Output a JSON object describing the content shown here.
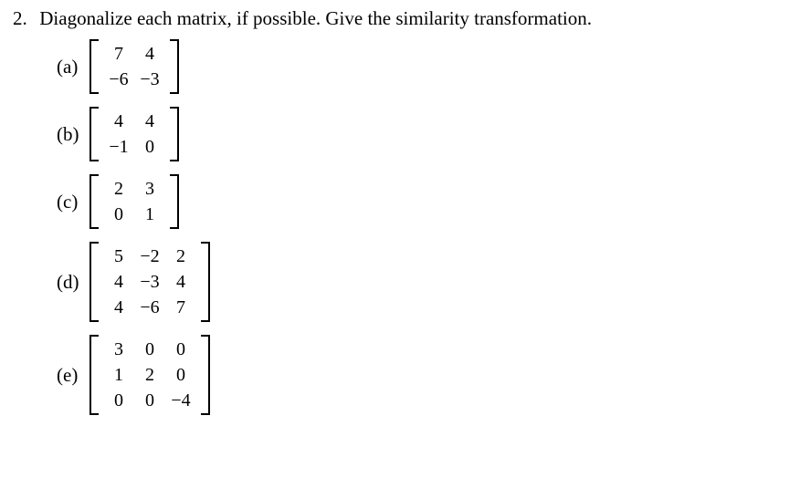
{
  "problem": {
    "number": "2.",
    "text": "Diagonalize each matrix, if possible. Give the similarity transformation."
  },
  "parts": [
    {
      "label": "(a)",
      "matrix": {
        "rows": 2,
        "cols": 2,
        "entries": [
          "7",
          "4",
          "−6",
          "−3"
        ]
      }
    },
    {
      "label": "(b)",
      "matrix": {
        "rows": 2,
        "cols": 2,
        "entries": [
          "4",
          "4",
          "−1",
          "0"
        ]
      }
    },
    {
      "label": "(c)",
      "matrix": {
        "rows": 2,
        "cols": 2,
        "entries": [
          "2",
          "3",
          "0",
          "1"
        ]
      }
    },
    {
      "label": "(d)",
      "matrix": {
        "rows": 3,
        "cols": 3,
        "entries": [
          "5",
          "−2",
          "2",
          "4",
          "−3",
          "4",
          "4",
          "−6",
          "7"
        ]
      }
    },
    {
      "label": "(e)",
      "matrix": {
        "rows": 3,
        "cols": 3,
        "entries": [
          "3",
          "0",
          "0",
          "1",
          "2",
          "0",
          "0",
          "0",
          "−4"
        ]
      }
    }
  ]
}
